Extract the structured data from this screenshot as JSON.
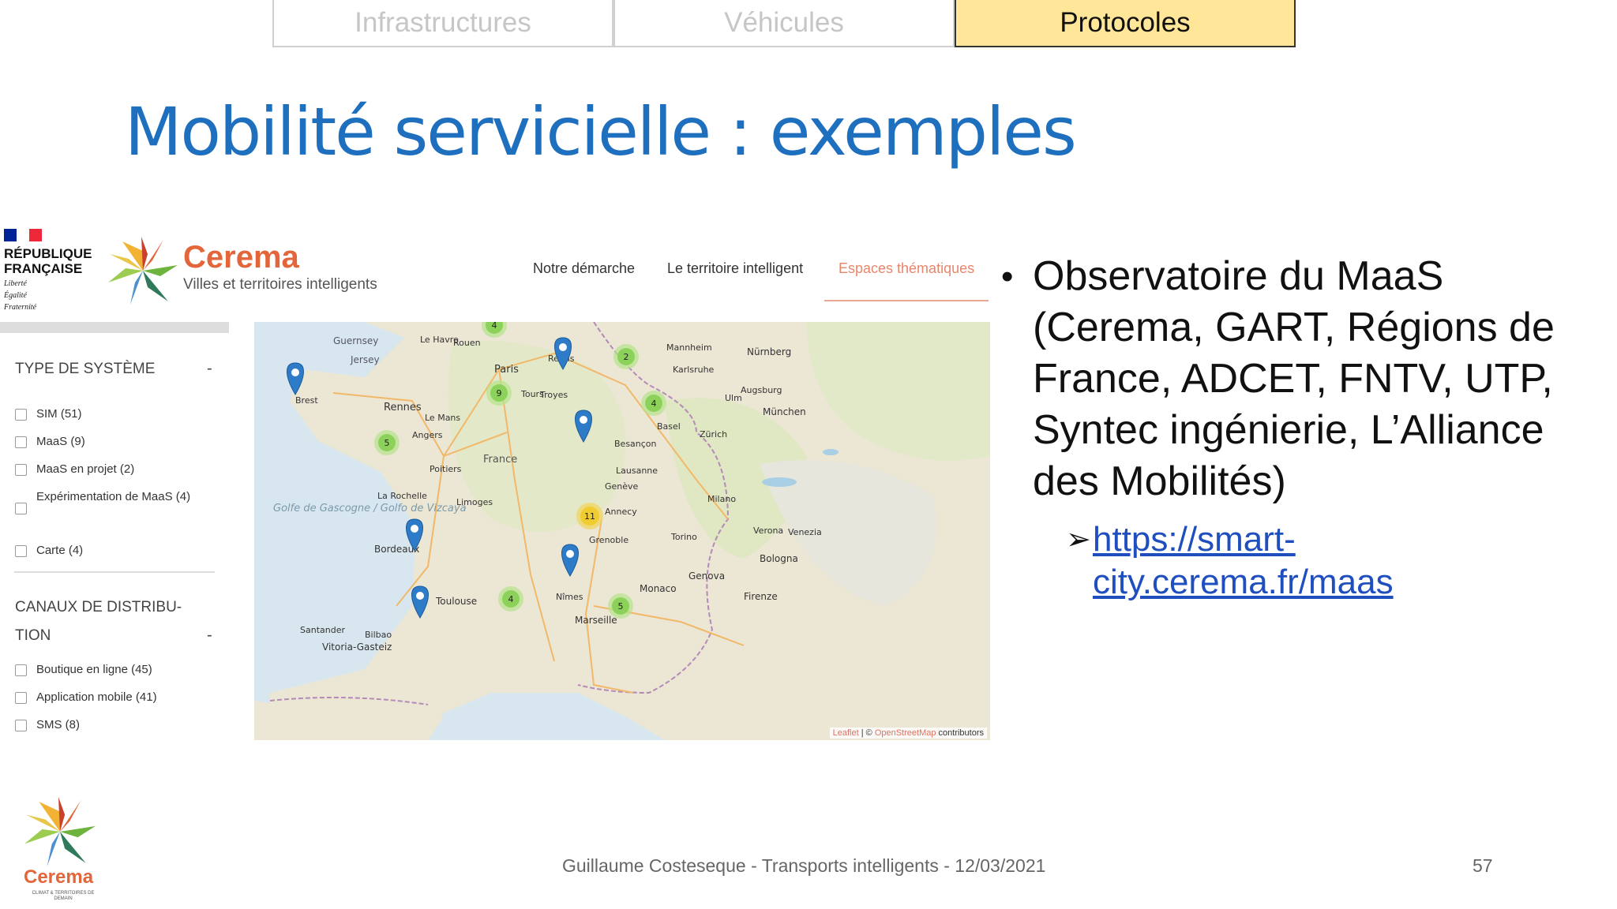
{
  "tabs": [
    {
      "label": "Infrastructures",
      "active": false
    },
    {
      "label": "Véhicules",
      "active": false
    },
    {
      "label": "Protocoles",
      "active": true
    }
  ],
  "title": "Mobilité servicielle : exemples",
  "site": {
    "republic": [
      "RÉPUBLIQUE",
      "FRANÇAISE"
    ],
    "devise": [
      "Liberté",
      "Égalité",
      "Fraternité"
    ],
    "brand": "Cerema",
    "tagline": "Villes et territoires intelligents",
    "nav": [
      "Notre démarche",
      "Le territoire intelligent",
      "Espaces thématiques"
    ],
    "active_nav": "Espaces thématiques"
  },
  "filters": {
    "system_title": "TYPE DE SYSTÈME",
    "system_toggle": "-",
    "system_items": [
      "SIM (51)",
      "MaaS (9)",
      "MaaS en projet (2)",
      "Expérimentation de MaaS (4)",
      "Carte (4)"
    ],
    "channel_title_1": "CANAUX DE DISTRIBU-",
    "channel_title_2": "TION",
    "channel_toggle": "-",
    "channel_items": [
      "Boutique en ligne (45)",
      "Application mobile (41)",
      "SMS (8)"
    ]
  },
  "map": {
    "attribution_leaflet": "Leaflet",
    "attribution_sep": " | © ",
    "attribution_osm": "OpenStreetMap",
    "attribution_rest": " contributors",
    "clusters": [
      "4",
      "2",
      "9",
      "4",
      "5",
      "11",
      "4",
      "5"
    ],
    "places": [
      "Guernsey",
      "Jersey",
      "Le Havre",
      "Rouen",
      "Paris",
      "Reims",
      "Brest",
      "Rennes",
      "Le Mans",
      "Angers",
      "Tours",
      "Troyes",
      "Poitiers",
      "La Rochelle",
      "Limoges",
      "Bordeaux",
      "Toulouse",
      "Nîmes",
      "Marseille",
      "Monaco",
      "Grenoble",
      "Annecy",
      "Genève",
      "Lausanne",
      "Besançon",
      "Basel",
      "Zürich",
      "Mannheim",
      "Karlsruhe",
      "Nürnberg",
      "Ulm",
      "Augsburg",
      "München",
      "Milano",
      "Torino",
      "Genova",
      "Bologna",
      "Firenze",
      "Verona",
      "Venezia",
      "Bilbao",
      "Santander",
      "Vitoria-Gasteiz",
      "France",
      "Golfe de Gascogne / Golfo de Vizcaya"
    ]
  },
  "bullets": [
    "Observatoire du MaaS (Cerema, GART, Régions de France, ADCET, FNTV, UTP, Syntec ingénierie, L’Alliance des Mobilités)"
  ],
  "link_1": "https://smart-",
  "link_2": "city.cerema.fr/maas",
  "footer": "Guillaume Costeseque - Transports intelligents - 12/03/2021",
  "page_number": "57",
  "footer_brand": "Cerema",
  "footer_tagline": "CLIMAT & TERRITOIRES DE DEMAIN",
  "colors": {
    "title": "#1f6fbf",
    "tab_active": "#ffe699",
    "brand": "#e3663b",
    "cluster_green": "#8cd25a",
    "cluster_yellow": "#f0cc30",
    "marker_blue": "#2e7cc8",
    "link": "#1f4fbf"
  }
}
